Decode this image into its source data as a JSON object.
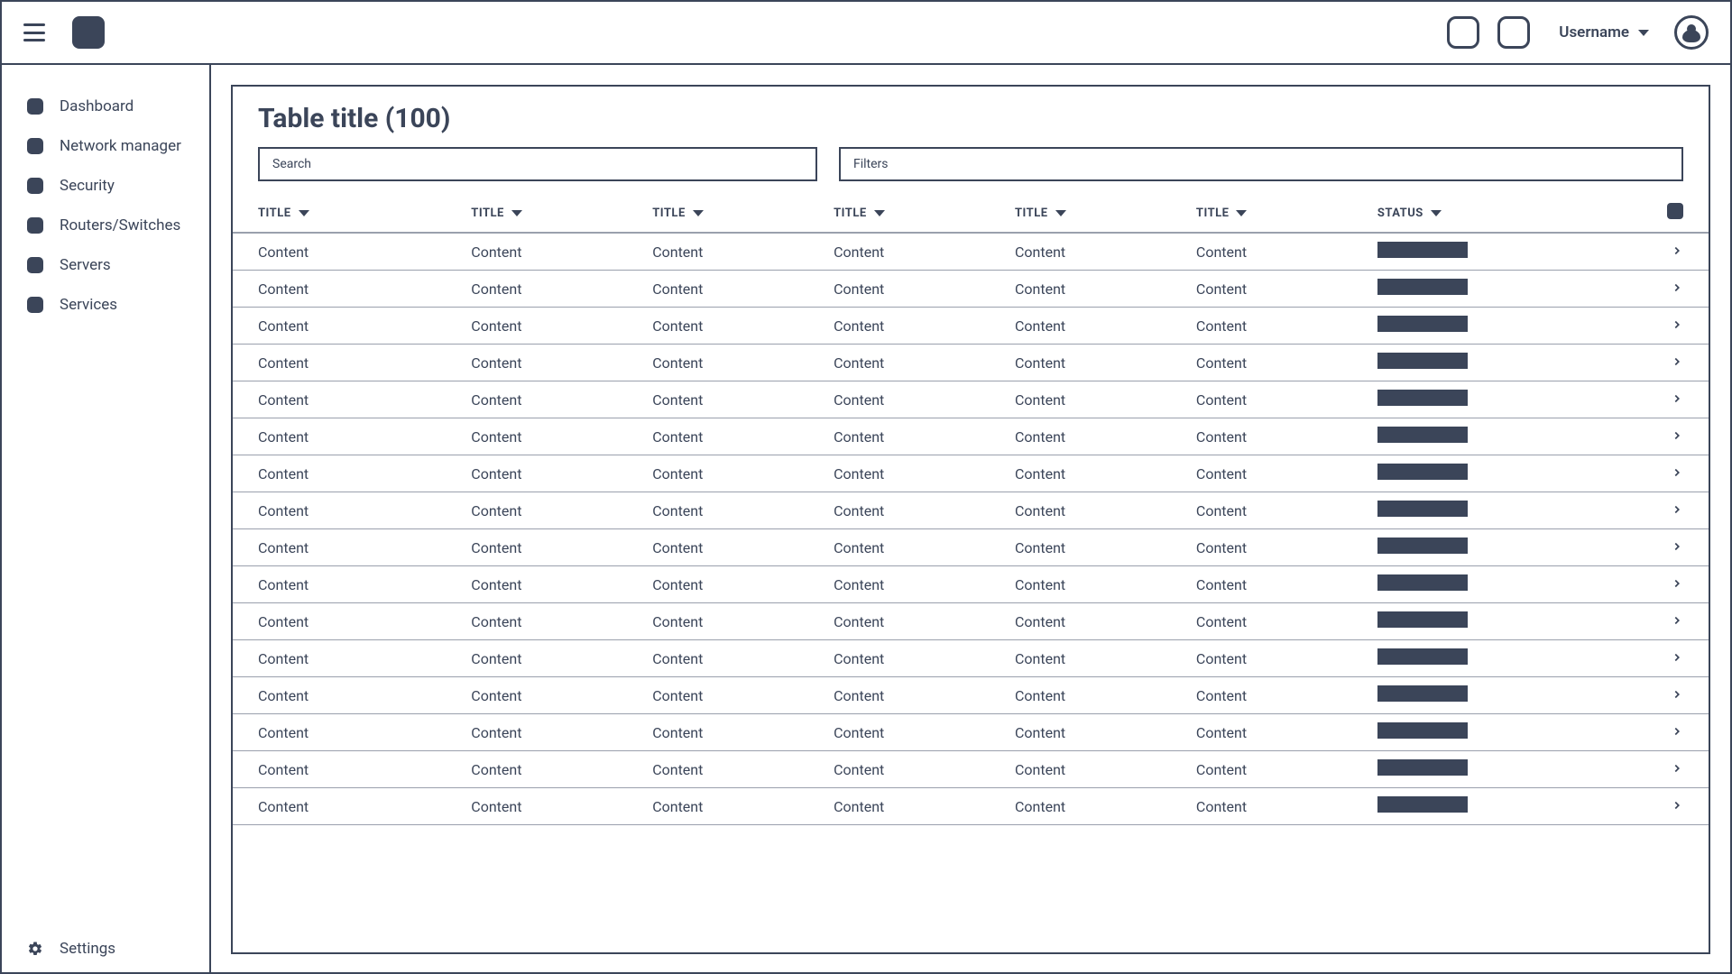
{
  "header": {
    "username": "Username"
  },
  "sidebar": {
    "items": [
      {
        "label": "Dashboard"
      },
      {
        "label": "Network manager"
      },
      {
        "label": "Security"
      },
      {
        "label": "Routers/Switches"
      },
      {
        "label": "Servers"
      },
      {
        "label": "Services"
      }
    ],
    "settings_label": "Settings"
  },
  "main": {
    "title": "Table title (100)",
    "search_placeholder": "Search",
    "filters_placeholder": "Filters",
    "columns": [
      "TITLE",
      "TITLE",
      "TITLE",
      "TITLE",
      "TITLE",
      "TITLE",
      "STATUS"
    ],
    "rows": [
      [
        "Content",
        "Content",
        "Content",
        "Content",
        "Content",
        "Content"
      ],
      [
        "Content",
        "Content",
        "Content",
        "Content",
        "Content",
        "Content"
      ],
      [
        "Content",
        "Content",
        "Content",
        "Content",
        "Content",
        "Content"
      ],
      [
        "Content",
        "Content",
        "Content",
        "Content",
        "Content",
        "Content"
      ],
      [
        "Content",
        "Content",
        "Content",
        "Content",
        "Content",
        "Content"
      ],
      [
        "Content",
        "Content",
        "Content",
        "Content",
        "Content",
        "Content"
      ],
      [
        "Content",
        "Content",
        "Content",
        "Content",
        "Content",
        "Content"
      ],
      [
        "Content",
        "Content",
        "Content",
        "Content",
        "Content",
        "Content"
      ],
      [
        "Content",
        "Content",
        "Content",
        "Content",
        "Content",
        "Content"
      ],
      [
        "Content",
        "Content",
        "Content",
        "Content",
        "Content",
        "Content"
      ],
      [
        "Content",
        "Content",
        "Content",
        "Content",
        "Content",
        "Content"
      ],
      [
        "Content",
        "Content",
        "Content",
        "Content",
        "Content",
        "Content"
      ],
      [
        "Content",
        "Content",
        "Content",
        "Content",
        "Content",
        "Content"
      ],
      [
        "Content",
        "Content",
        "Content",
        "Content",
        "Content",
        "Content"
      ],
      [
        "Content",
        "Content",
        "Content",
        "Content",
        "Content",
        "Content"
      ],
      [
        "Content",
        "Content",
        "Content",
        "Content",
        "Content",
        "Content"
      ]
    ]
  }
}
